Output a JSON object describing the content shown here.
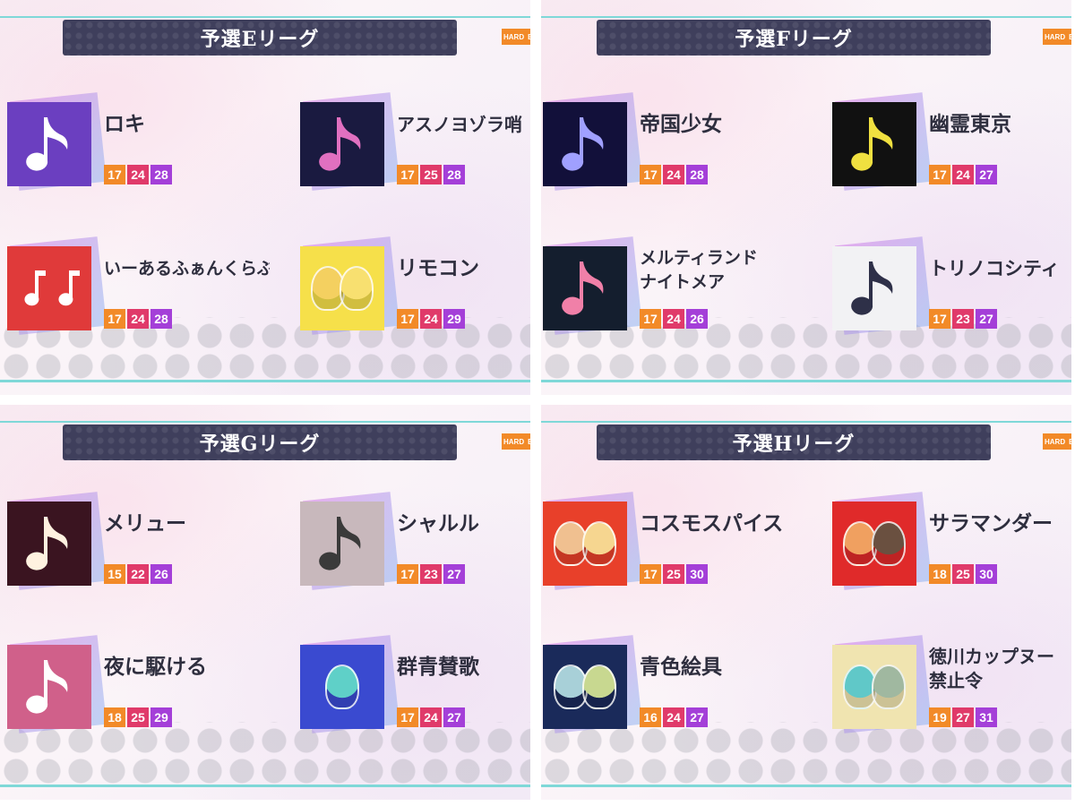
{
  "leagues": [
    {
      "title": "予選Eリーグ",
      "diff_tag": "HARD",
      "diff_tag_next": "E",
      "songs": [
        {
          "name": "ロキ",
          "levels": [
            "17",
            "24",
            "28"
          ],
          "jacket_bg": "#6b3fc0",
          "note_color": "#ffffff",
          "jacket_type": "note"
        },
        {
          "name": "アスノヨゾラ哨",
          "levels": [
            "17",
            "25",
            "28"
          ],
          "jacket_bg": "#1a1a40",
          "note_color": "#e070c0",
          "jacket_type": "note"
        },
        {
          "name": "いーあるふぁんくらぶ",
          "levels": [
            "17",
            "24",
            "28"
          ],
          "jacket_bg": "#e03a3a",
          "note_color": "#ffffff",
          "jacket_type": "notes"
        },
        {
          "name": "リモコン",
          "levels": [
            "17",
            "24",
            "29"
          ],
          "jacket_bg": "#f6e04a",
          "note_color": "#ffffff",
          "jacket_type": "chara",
          "chara_colors": [
            "#f4d060",
            "#f8e070"
          ]
        }
      ]
    },
    {
      "title": "予選Fリーグ",
      "diff_tag": "HARD",
      "diff_tag_next": "E",
      "songs": [
        {
          "name": "帝国少女",
          "levels": [
            "17",
            "24",
            "28"
          ],
          "jacket_bg": "#12103a",
          "note_color": "#a0a0ff",
          "jacket_type": "note"
        },
        {
          "name": "幽霊東京",
          "levels": [
            "17",
            "24",
            "27"
          ],
          "jacket_bg": "#111111",
          "note_color": "#f0e040",
          "jacket_type": "note"
        },
        {
          "name_line1": "メルティランド",
          "name_line2": "ナイトメア",
          "levels": [
            "17",
            "24",
            "26"
          ],
          "jacket_bg": "#141e2e",
          "note_color": "#f080a8",
          "jacket_type": "note"
        },
        {
          "name": "トリノコシティ",
          "levels": [
            "17",
            "23",
            "27"
          ],
          "jacket_bg": "#f2f2f4",
          "note_color": "#2e3048",
          "jacket_type": "note"
        }
      ]
    },
    {
      "title": "予選Gリーグ",
      "diff_tag": "HARD",
      "diff_tag_next": "E",
      "songs": [
        {
          "name": "メリュー",
          "levels": [
            "15",
            "22",
            "26"
          ],
          "jacket_bg": "#3a1420",
          "note_color": "#fff2e0",
          "jacket_type": "note"
        },
        {
          "name": "シャルル",
          "levels": [
            "17",
            "23",
            "27"
          ],
          "jacket_bg": "#c8b8bc",
          "note_color": "#3a3a3a",
          "jacket_type": "note"
        },
        {
          "name": "夜に駆ける",
          "levels": [
            "18",
            "25",
            "29"
          ],
          "jacket_bg": "#d0608a",
          "note_color": "#ffffff",
          "jacket_type": "note"
        },
        {
          "name": "群青賛歌",
          "levels": [
            "17",
            "24",
            "27"
          ],
          "jacket_bg": "#3a4ad0",
          "note_color": "#ffffff",
          "jacket_type": "chara",
          "chara_colors": [
            "#5fd0c8"
          ]
        }
      ]
    },
    {
      "title": "予選Hリーグ",
      "diff_tag": "HARD",
      "diff_tag_next": "E",
      "songs": [
        {
          "name": "コスモスパイス",
          "levels": [
            "17",
            "25",
            "30"
          ],
          "jacket_bg": "#e8402a",
          "note_color": "#ffffff",
          "jacket_type": "chara",
          "chara_colors": [
            "#f0c090",
            "#f6d690"
          ]
        },
        {
          "name": "サラマンダー",
          "levels": [
            "18",
            "25",
            "30"
          ],
          "jacket_bg": "#e02a2a",
          "note_color": "#ffffff",
          "jacket_type": "chara",
          "chara_colors": [
            "#f0a060",
            "#6a5040"
          ]
        },
        {
          "name": "青色絵具",
          "levels": [
            "16",
            "24",
            "27"
          ],
          "jacket_bg": "#1a2a5a",
          "note_color": "#ffffff",
          "jacket_type": "chara",
          "chara_colors": [
            "#a8d0d8",
            "#c8d890"
          ]
        },
        {
          "name_line1": "徳川カップヌー",
          "name_line2": "禁止令",
          "levels": [
            "19",
            "27",
            "31"
          ],
          "jacket_bg": "#f0e4b0",
          "note_color": "#ffffff",
          "jacket_type": "chara",
          "chara_colors": [
            "#60c8c8",
            "#a0b8a0"
          ]
        }
      ]
    }
  ]
}
